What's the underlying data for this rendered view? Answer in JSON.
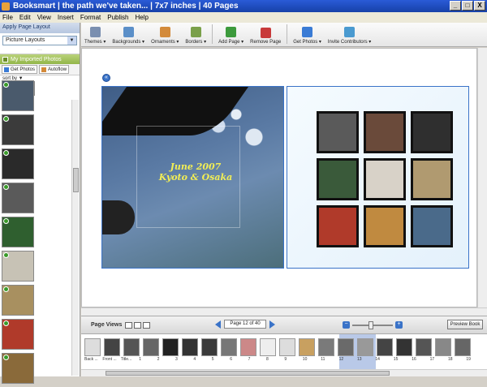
{
  "window": {
    "title": "Booksmart  |  the path we've taken...  |  7x7 inches  |  40 Pages",
    "controls": [
      "_",
      "□",
      "X"
    ]
  },
  "menu": [
    "File",
    "Edit",
    "View",
    "Insert",
    "Format",
    "Publish",
    "Help"
  ],
  "sidebar": {
    "layout_header": "Apply Page Layout",
    "layout_select": "Picture Layouts",
    "photos_header": "My Imported Photos",
    "get_photos": "Get Photos",
    "autoflow": "Autoflow",
    "sort_by": "sort by ▼",
    "thumb_colors": [
      "#4a5a6c",
      "#3b3b3b",
      "#2a2a2a",
      "#5a5a5a",
      "#2f5f2f",
      "#c7c2b5",
      "#a89060",
      "#b03a2a",
      "#8a6a3a"
    ]
  },
  "toolbar": {
    "buttons": [
      {
        "label": "Themes ▾",
        "color": "#7a8fb0"
      },
      {
        "label": "Backgrounds ▾",
        "color": "#5b8fc8"
      },
      {
        "label": "Ornaments ▾",
        "color": "#d38a3a"
      },
      {
        "label": "Borders ▾",
        "color": "#7aa04a"
      },
      {
        "label": "Add Page ▾",
        "color": "#3c9a3c"
      },
      {
        "label": "Remove Page",
        "color": "#c83a3a"
      },
      {
        "label": "Get Photos ▾",
        "color": "#3a7bd5"
      },
      {
        "label": "Invite Contributors ▾",
        "color": "#4a9ad0"
      }
    ]
  },
  "page": {
    "caption_line1": "June 2007",
    "caption_line2": "Kyoto & Osaka",
    "grid_colors": [
      "#5a5a5a",
      "#6a4a3a",
      "#2f2f2f",
      "#3a5a3a",
      "#d8d2c8",
      "#b09a70",
      "#b03a2a",
      "#c08a40",
      "#4a6a8a"
    ]
  },
  "page_views": {
    "label": "Page Views",
    "page_indicator": "Page 12 of 40",
    "preview": "Preview Book"
  },
  "strip": {
    "labels": [
      "Back ...",
      "Front ...",
      "Title...",
      "1",
      "2",
      "3",
      "4",
      "5",
      "6",
      "7",
      "8",
      "9",
      "10",
      "11",
      "12",
      "13",
      "14",
      "15",
      "16",
      "17",
      "18",
      "19"
    ]
  }
}
